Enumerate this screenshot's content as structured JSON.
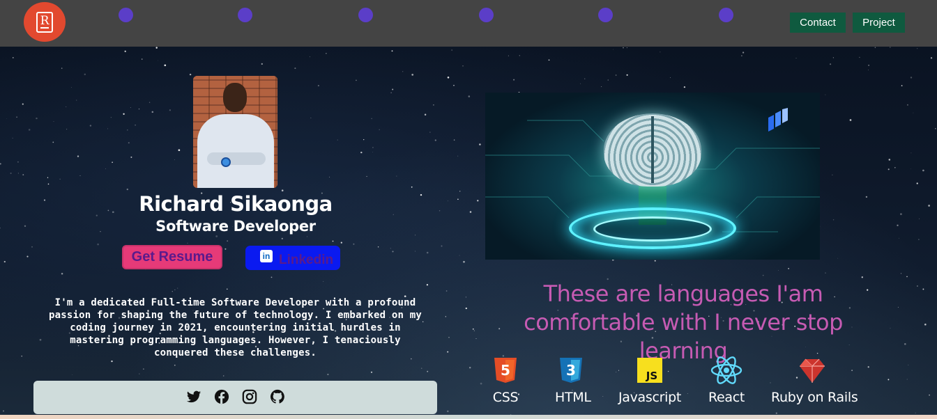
{
  "header": {
    "logo_letter": "R",
    "nav": [
      {
        "label": "Contact"
      },
      {
        "label": "Project"
      }
    ]
  },
  "profile": {
    "name": "Richard Sikaonga",
    "role": "Software Developer",
    "resume_label": "Get Resume",
    "linkedin_label": "Linkedin",
    "linkedin_icon_text": "in",
    "bio": "I'm a dedicated Full-time Software Developer with a profound passion for shaping the future of technology. I embarked on my coding journey in 2021, encountering initial hurdles in mastering programming languages. However, I tenaciously conquered these challenges."
  },
  "social": [
    "twitter-icon",
    "facebook-icon",
    "instagram-icon",
    "github-icon"
  ],
  "headline": "These are languages I'am comfortable with I never stop learning",
  "skills": [
    {
      "label": "CSS",
      "icon": "html5-icon",
      "color": "#e44d26",
      "glyph": "5"
    },
    {
      "label": "HTML",
      "icon": "css3-icon",
      "color": "#1572b6",
      "glyph": "3"
    },
    {
      "label": "Javascript",
      "icon": "js-icon",
      "color": "#f7df1e",
      "glyph": "JS"
    },
    {
      "label": "React",
      "icon": "react-icon",
      "color": "#61dafb"
    },
    {
      "label": "Ruby on Rails",
      "icon": "ruby-icon",
      "color": "#cc342d"
    }
  ],
  "colors": {
    "header_bg": "#444444",
    "nav_button": "#0f5a3f",
    "logo": "#e2492f",
    "nav_dot": "#5b3ec8",
    "headline": "#c65bb3",
    "resume_button": "#e63a78",
    "linkedin_button": "#0a1af0",
    "social_bar": "#cfdcdb"
  }
}
